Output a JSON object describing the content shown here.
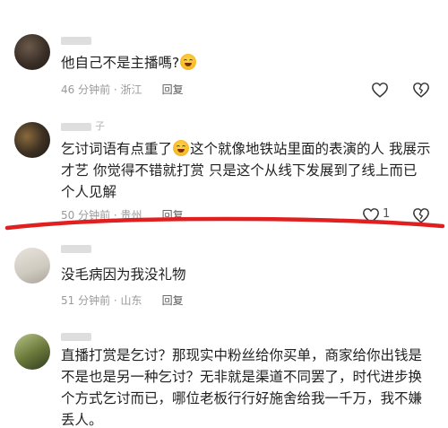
{
  "comments": [
    {
      "username": "",
      "text_before": "他自己不是主播嗎?",
      "text_after": "",
      "time": "46 分钟前",
      "location": "浙江",
      "reply_label": "回复",
      "likes": ""
    },
    {
      "username": "子",
      "text_before": "乞讨词语有点重了",
      "text_after": "这个就像地铁站里面的表演的人 我展示才艺 你觉得不错就打赏 只是这个从线下发展到了线上而已 个人见解",
      "time": "50 分钟前",
      "location": "贵州",
      "reply_label": "回复",
      "likes": "1"
    },
    {
      "username": "",
      "text_before": "没毛病因为我没礼物",
      "text_after": "",
      "time": "51 分钟前",
      "location": "山东",
      "reply_label": "回复",
      "likes": ""
    },
    {
      "username": "",
      "text_before": "直播打赏是乞讨？那现实中粉丝给你买单，商家给你出钱是不是也是另一种乞讨？无非就是渠道不同罢了，时代进步换个方式乞讨而已，哪位老板行行好施舍给我一千万，我不嫌丢人。",
      "text_after": "",
      "time": "",
      "location": "",
      "reply_label": "",
      "likes": ""
    }
  ],
  "separator": " · ",
  "colors": {
    "annotation_red": "#e02020",
    "meta_gray": "#9a9a9a",
    "text": "#1f1f1f"
  },
  "icons": {
    "like": "heart-outline-icon",
    "dislike": "broken-heart-outline-icon",
    "emoji": "laughing-tears-emoji-icon"
  }
}
